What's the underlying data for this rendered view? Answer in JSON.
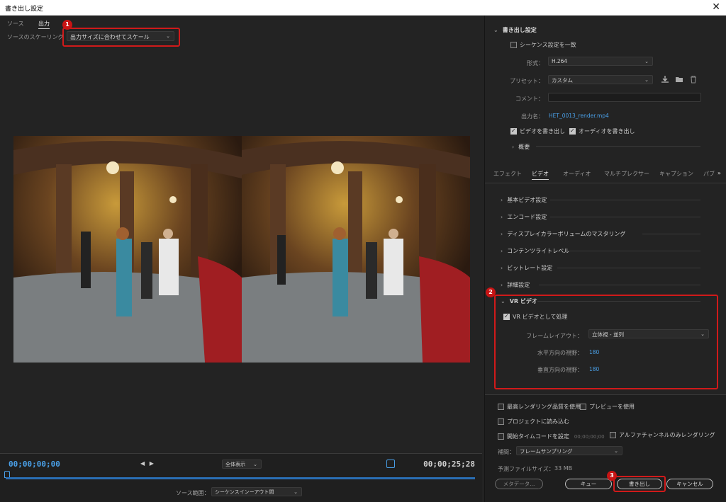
{
  "window": {
    "title": "書き出し設定",
    "close_glyph": "✕"
  },
  "left": {
    "tabs": [
      {
        "label": "ソース"
      },
      {
        "label": "出力"
      }
    ],
    "scaling_label": "ソースのスケーリング",
    "scaling_value": "出力サイズに合わせてスケール",
    "timeline": {
      "timecode_in": "00;00;00;00",
      "timecode_out": "00;00;25;28",
      "fit_value": "全体表示",
      "source_range_label": "ソース範囲：",
      "source_range_value": "シーケンスインーアウト間",
      "progress": 1.0
    }
  },
  "export": {
    "section_title": "書き出し設定",
    "match_sequence": {
      "label": "シーケンス設定を一致",
      "checked": false
    },
    "format_label": "形式：",
    "format_value": "H.264",
    "preset_label": "プリセット：",
    "preset_value": "カスタム",
    "comment_label": "コメント：",
    "comment_value": "",
    "output_name_label": "出力名：",
    "output_name_value": "HET_0013_render.mp4",
    "export_video": {
      "label": "ビデオを書き出し",
      "checked": true
    },
    "export_audio": {
      "label": "オーディオを書き出し",
      "checked": true
    },
    "summary_label": "概要"
  },
  "settings_tabs": [
    {
      "label": "エフェクト"
    },
    {
      "label": "ビデオ"
    },
    {
      "label": "オーディオ"
    },
    {
      "label": "マルチプレクサー"
    },
    {
      "label": "キャプション"
    },
    {
      "label": "パブ"
    }
  ],
  "settings_tabs_more": "»",
  "video_sections": [
    {
      "label": "基本ビデオ設定"
    },
    {
      "label": "エンコード設定"
    },
    {
      "label": "ディスプレイカラーボリュームのマスタリング"
    },
    {
      "label": "コンテンツライトレベル"
    },
    {
      "label": "ビットレート設定"
    },
    {
      "label": "詳細設定"
    }
  ],
  "vr": {
    "section_title": "VR ビデオ",
    "process_as_vr": {
      "label": "VR ビデオとして処理",
      "checked": true
    },
    "frame_layout_label": "フレームレイアウト：",
    "frame_layout_value": "立体視 - 並列",
    "horizontal_label": "水平方向の視野：",
    "horizontal_value": "180",
    "vertical_label": "垂直方向の視野：",
    "vertical_value": "180"
  },
  "bottom": {
    "max_render_quality": {
      "label": "最高レンダリング品質を使用",
      "checked": false
    },
    "use_previews": {
      "label": "プレビューを使用",
      "checked": false
    },
    "import_into_project": {
      "label": "プロジェクトに読み込む",
      "checked": false
    },
    "set_start_timecode": {
      "label": "開始タイムコードを設定",
      "checked": false,
      "value": "00;00;00;00"
    },
    "render_alpha_only": {
      "label": "アルファチャンネルのみレンダリング",
      "checked": false
    },
    "interpolation_label": "補間：",
    "interpolation_value": "フレームサンプリング",
    "estimated_size_label": "予測ファイルサイズ：",
    "estimated_size_value": "33 MB",
    "metadata_button": "メタデータ...",
    "queue_button": "キュー",
    "export_button": "書き出し",
    "cancel_button": "キャンセル"
  },
  "callouts": [
    {
      "number": "1"
    },
    {
      "number": "2"
    },
    {
      "number": "3"
    }
  ],
  "colors": {
    "accent_blue": "#4aa0e8",
    "callout_red": "#d01a1a",
    "panel_bg": "#232323"
  }
}
